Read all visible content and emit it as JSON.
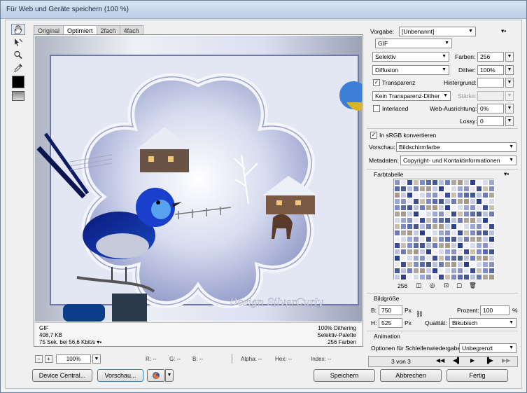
{
  "window": {
    "title": "Für Web und Geräte speichern (100 %)"
  },
  "tabs": [
    "Original",
    "Optimiert",
    "2fach",
    "4fach"
  ],
  "tools": [
    "hand-icon",
    "slice-select-icon",
    "zoom-icon",
    "eyedropper-icon"
  ],
  "preview": {
    "watermark": "Design SilverCurly",
    "info_left": [
      "GIF",
      "408,7 KB",
      "75 Sek. bei 56,6 Kbit/s"
    ],
    "info_right": [
      "100% Dithering",
      "Selektiv-Palette",
      "256 Farben"
    ]
  },
  "status": {
    "zoom": "100%",
    "r": "R: --",
    "g": "G: --",
    "b": "B: --",
    "alpha": "Alpha: --",
    "hex": "Hex: --",
    "index": "Index: --"
  },
  "buttons": {
    "device_central": "Device Central...",
    "preview": "Vorschau...",
    "save": "Speichern",
    "cancel": "Abbrechen",
    "done": "Fertig"
  },
  "settings": {
    "preset_label": "Vorgabe:",
    "preset_value": "[Unbenannt]",
    "format": "GIF",
    "reduction": "Selektiv",
    "colors_label": "Farben:",
    "colors_value": "256",
    "dither_algo": "Diffusion",
    "dither_label": "Dither:",
    "dither_value": "100%",
    "transparency_label": "Transparenz",
    "transparency_checked": true,
    "matte_label": "Hintergrund:",
    "transparency_dither": "Kein Transparenz-Dither",
    "amount_label": "Stärke:",
    "interlaced_label": "Interlaced",
    "interlaced_checked": false,
    "web_snap_label": "Web-Ausrichtung:",
    "web_snap_value": "0%",
    "lossy_label": "Lossy:",
    "lossy_value": "0",
    "srgb_label": "In sRGB konvertieren",
    "srgb_checked": true,
    "preview_label": "Vorschau:",
    "preview_value": "Bildschirmfarbe",
    "metadata_label": "Metadaten:",
    "metadata_value": "Copyright- und Kontaktinformationen"
  },
  "color_table": {
    "title": "Farbtabelle",
    "count": "256"
  },
  "image_size": {
    "title": "Bildgröße",
    "w_label": "B:",
    "w_value": "750",
    "w_unit": "Px",
    "h_label": "H:",
    "h_value": "525",
    "h_unit": "Px",
    "percent_label": "Prozent:",
    "percent_value": "100",
    "percent_unit": "%",
    "quality_label": "Qualität:",
    "quality_value": "Bikubisch"
  },
  "animation": {
    "title": "Animation",
    "loop_label": "Optionen für Schleifenwiedergabe:",
    "loop_value": "Unbegrenzt",
    "frame_counter": "3 von 3"
  }
}
